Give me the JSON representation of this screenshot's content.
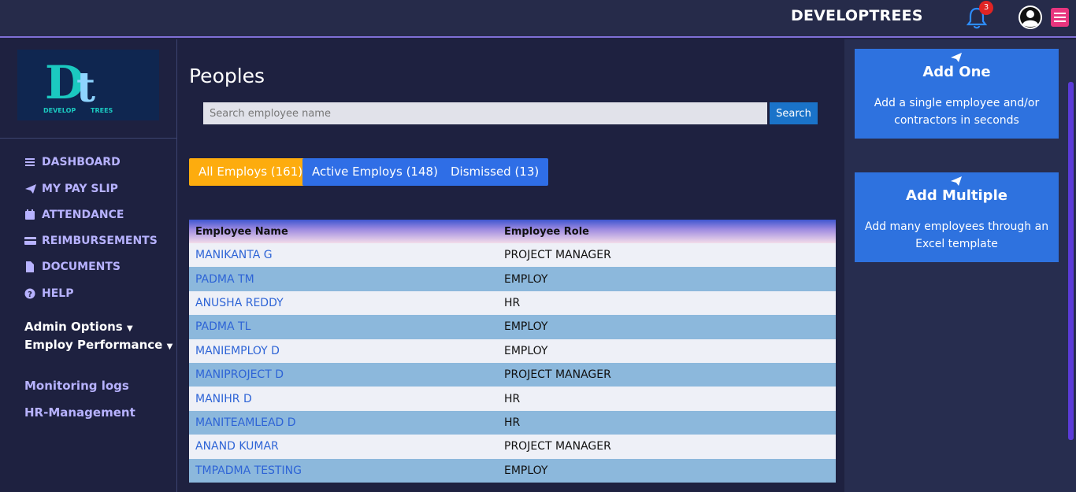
{
  "header": {
    "brand": "DEVELOPTREES",
    "notification_count": "3"
  },
  "sidebar": {
    "nav": [
      {
        "label": "DASHBOARD",
        "icon": "list-icon"
      },
      {
        "label": "MY PAY SLIP",
        "icon": "paper-plane-icon"
      },
      {
        "label": "ATTENDANCE",
        "icon": "calendar-icon"
      },
      {
        "label": "REIMBURSEMENTS",
        "icon": "card-icon"
      },
      {
        "label": "DOCUMENTS",
        "icon": "file-icon"
      },
      {
        "label": "HELP",
        "icon": "question-icon"
      }
    ],
    "admin_options": "Admin Options",
    "employ_performance": "Employ Performance",
    "monitoring_logs": "Monitoring logs",
    "hr_management": "HR-Management"
  },
  "main": {
    "title": "Peoples",
    "search": {
      "placeholder": "Search employee name",
      "button": "Search"
    },
    "tabs": [
      {
        "label": "All Employs (161)",
        "color": "#fdac0e"
      },
      {
        "label": "Active Employs (148)",
        "color": "#2f6ee6"
      },
      {
        "label": "Dismissed (13)",
        "color": "#2f6ee6"
      }
    ],
    "table": {
      "columns": [
        "Employee Name",
        "Employee Role"
      ],
      "rows": [
        {
          "name": "MANIKANTA G",
          "role": "PROJECT MANAGER"
        },
        {
          "name": "PADMA TM",
          "role": "EMPLOY"
        },
        {
          "name": "ANUSHA REDDY",
          "role": "HR"
        },
        {
          "name": "PADMA TL",
          "role": "EMPLOY"
        },
        {
          "name": "MANIEMPLOY D",
          "role": "EMPLOY"
        },
        {
          "name": "MANIPROJECT D",
          "role": "PROJECT MANAGER"
        },
        {
          "name": "MANIHR D",
          "role": "HR"
        },
        {
          "name": "MANITEAMLEAD D",
          "role": "HR"
        },
        {
          "name": "ANAND KUMAR",
          "role": "PROJECT MANAGER"
        },
        {
          "name": "TMPADMA TESTING",
          "role": "EMPLOY"
        }
      ]
    }
  },
  "right_panel": {
    "add_one": {
      "title": "Add One",
      "desc": "Add a single employee and/or contractors in seconds"
    },
    "add_multiple": {
      "title": "Add Multiple",
      "desc": "Add many employees through an Excel template"
    }
  },
  "colors": {
    "accent": "#2f6ee6",
    "badge": "#e02424",
    "menu": "#e8357e"
  }
}
